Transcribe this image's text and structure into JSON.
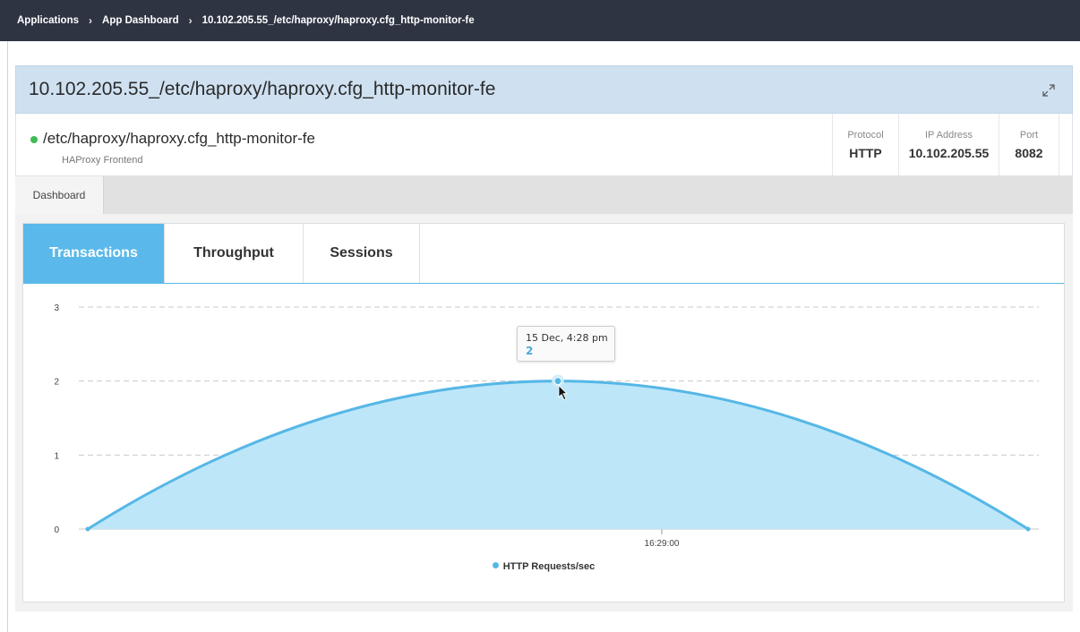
{
  "breadcrumb": {
    "items": [
      "Applications",
      "App Dashboard",
      "10.102.205.55_/etc/haproxy/haproxy.cfg_http-monitor-fe"
    ],
    "separator": "›"
  },
  "page": {
    "title": "10.102.205.55_/etc/haproxy/haproxy.cfg_http-monitor-fe"
  },
  "entity": {
    "name": "/etc/haproxy/haproxy.cfg_http-monitor-fe",
    "type": "HAProxy Frontend",
    "status_color": "#3dbb55",
    "protocol_label": "Protocol",
    "protocol_value": "HTTP",
    "ip_label": "IP Address",
    "ip_value": "10.102.205.55",
    "port_label": "Port",
    "port_value": "8082"
  },
  "tabs": {
    "dashboard_label": "Dashboard"
  },
  "chart_tabs": [
    {
      "label": "Transactions",
      "active": true
    },
    {
      "label": "Throughput",
      "active": false
    },
    {
      "label": "Sessions",
      "active": false
    }
  ],
  "tooltip": {
    "label": "15 Dec, 4:28 pm",
    "value": "2"
  },
  "colors": {
    "accent": "#5ab9ea",
    "area_fill": "#b9e6f9",
    "line": "#56b7e6",
    "breadcrumb_bg": "#2e3442",
    "title_bar_bg": "#cfe1f1"
  },
  "chart_data": {
    "type": "area",
    "x": [
      "",
      "15 Dec, 4:28 pm",
      ""
    ],
    "x_tick_labels": [
      "16:29:00"
    ],
    "series": [
      {
        "name": "HTTP Requests/sec",
        "values": [
          0,
          2,
          0
        ]
      }
    ],
    "ylim": [
      0,
      3
    ],
    "y_ticks": [
      0,
      1,
      2,
      3
    ],
    "grid": "horizontal-dashed",
    "legend": "bottom-center",
    "title": "",
    "xlabel": "",
    "ylabel": ""
  }
}
